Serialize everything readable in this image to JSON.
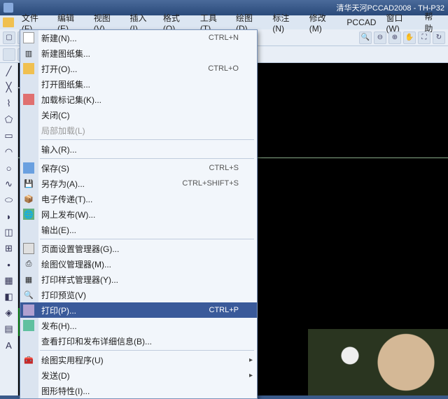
{
  "title": "清华天河PCCAD2008 - TH-P32",
  "menubar": [
    "文件(F)",
    "编辑(E)",
    "视图(V)",
    "插入(I)",
    "格式(O)",
    "工具(T)",
    "绘图(D)",
    "标注(N)",
    "修改(M)",
    "PCCAD",
    "窗口(W)",
    "帮助"
  ],
  "menu": {
    "new": {
      "label": "新建(N)...",
      "shortcut": "CTRL+N"
    },
    "newsheet": {
      "label": "新建图纸集..."
    },
    "open": {
      "label": "打开(O)...",
      "shortcut": "CTRL+O"
    },
    "opensheet": {
      "label": "打开图纸集..."
    },
    "loadmk": {
      "label": "加载标记集(K)..."
    },
    "close": {
      "label": "关闭(C)"
    },
    "partial": {
      "label": "局部加载(L)"
    },
    "import": {
      "label": "输入(R)..."
    },
    "save": {
      "label": "保存(S)",
      "shortcut": "CTRL+S"
    },
    "saveas": {
      "label": "另存为(A)...",
      "shortcut": "CTRL+SHIFT+S"
    },
    "etrans": {
      "label": "电子传递(T)..."
    },
    "webpub": {
      "label": "网上发布(W)..."
    },
    "export": {
      "label": "输出(E)..."
    },
    "pagesetup": {
      "label": "页面设置管理器(G)..."
    },
    "plotter": {
      "label": "绘图仪管理器(M)..."
    },
    "plotstyle": {
      "label": "打印样式管理器(Y)..."
    },
    "preview": {
      "label": "打印预览(V)"
    },
    "print": {
      "label": "打印(P)...",
      "shortcut": "CTRL+P"
    },
    "publish": {
      "label": "发布(H)..."
    },
    "viewplot": {
      "label": "查看打印和发布详细信息(B)..."
    },
    "util": {
      "label": "绘图实用程序(U)"
    },
    "send": {
      "label": "发送(D)"
    },
    "props": {
      "label": "图形特性(I)..."
    }
  }
}
